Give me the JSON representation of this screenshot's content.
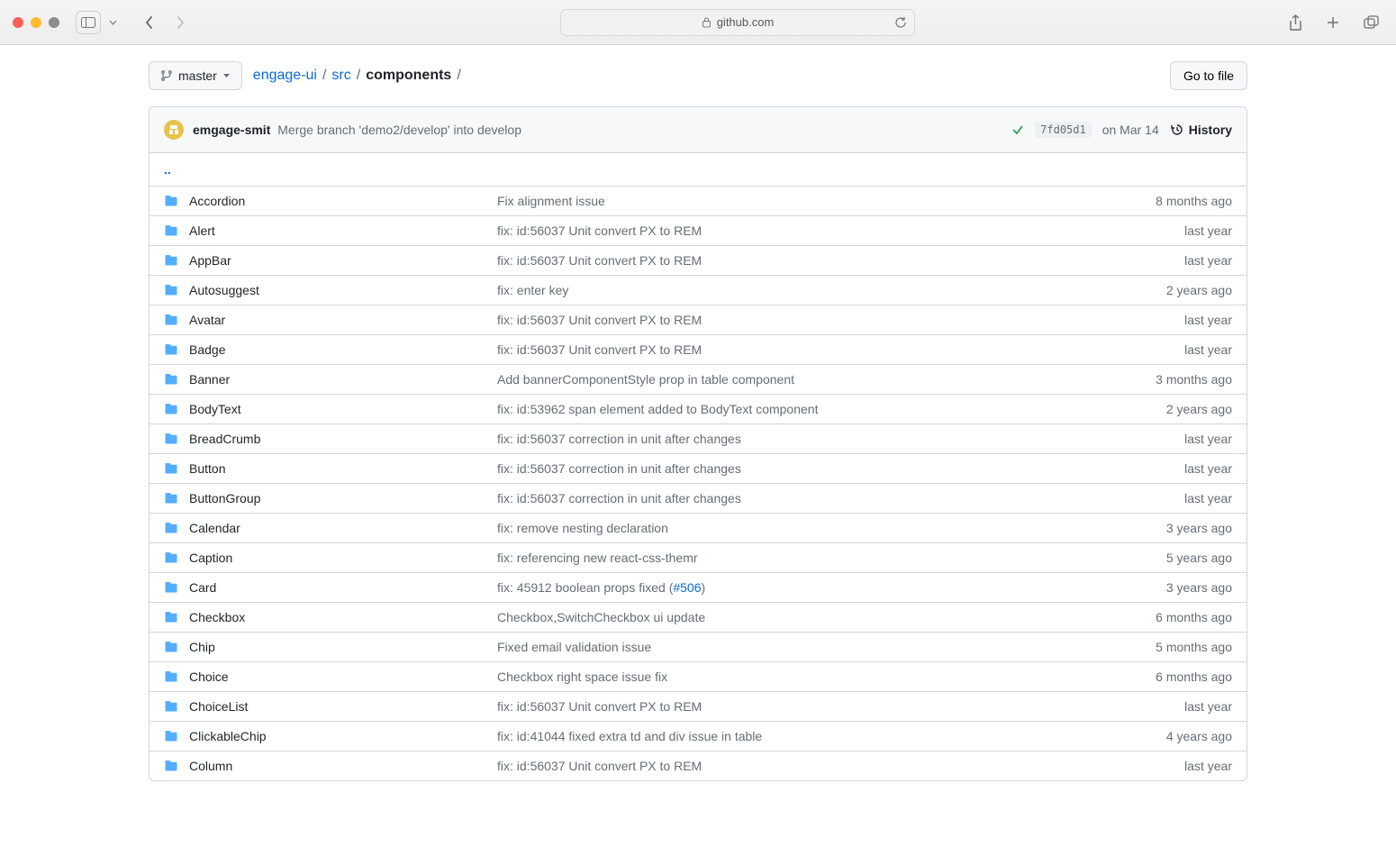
{
  "browser": {
    "domain": "github.com"
  },
  "branch": {
    "label": "master"
  },
  "breadcrumbs": {
    "repo": "engage-ui",
    "path1": "src",
    "current": "components"
  },
  "go_to_file": "Go to file",
  "commit": {
    "author": "emgage-smit",
    "message": "Merge branch 'demo2/develop' into develop",
    "sha": "7fd05d1",
    "date": "on Mar 14",
    "history": "History"
  },
  "parent_link": "..",
  "files": [
    {
      "name": "Accordion",
      "msg": "Fix alignment issue",
      "time": "8 months ago"
    },
    {
      "name": "Alert",
      "msg": "fix: id:56037 Unit convert PX to REM",
      "time": "last year"
    },
    {
      "name": "AppBar",
      "msg": "fix: id:56037 Unit convert PX to REM",
      "time": "last year"
    },
    {
      "name": "Autosuggest",
      "msg": "fix: enter key",
      "time": "2 years ago"
    },
    {
      "name": "Avatar",
      "msg": "fix: id:56037 Unit convert PX to REM",
      "time": "last year"
    },
    {
      "name": "Badge",
      "msg": "fix: id:56037 Unit convert PX to REM",
      "time": "last year"
    },
    {
      "name": "Banner",
      "msg": "Add bannerComponentStyle prop in table component",
      "time": "3 months ago"
    },
    {
      "name": "BodyText",
      "msg": "fix: id:53962 span element added to BodyText component",
      "time": "2 years ago"
    },
    {
      "name": "BreadCrumb",
      "msg": "fix: id:56037 correction in unit after changes",
      "time": "last year"
    },
    {
      "name": "Button",
      "msg": "fix: id:56037 correction in unit after changes",
      "time": "last year"
    },
    {
      "name": "ButtonGroup",
      "msg": "fix: id:56037 correction in unit after changes",
      "time": "last year"
    },
    {
      "name": "Calendar",
      "msg": "fix: remove nesting declaration",
      "time": "3 years ago"
    },
    {
      "name": "Caption",
      "msg": "fix: referencing new react-css-themr",
      "time": "5 years ago"
    },
    {
      "name": "Card",
      "msg": "fix: 45912 boolean props fixed (",
      "msg_link": "#506",
      "msg_after": ")",
      "time": "3 years ago"
    },
    {
      "name": "Checkbox",
      "msg": "Checkbox,SwitchCheckbox ui update",
      "time": "6 months ago"
    },
    {
      "name": "Chip",
      "msg": "Fixed email validation issue",
      "time": "5 months ago"
    },
    {
      "name": "Choice",
      "msg": "Checkbox right space issue fix",
      "time": "6 months ago"
    },
    {
      "name": "ChoiceList",
      "msg": "fix: id:56037 Unit convert PX to REM",
      "time": "last year"
    },
    {
      "name": "ClickableChip",
      "msg": "fix: id:41044 fixed extra td and div issue in table",
      "time": "4 years ago"
    },
    {
      "name": "Column",
      "msg": "fix: id:56037 Unit convert PX to REM",
      "time": "last year"
    }
  ]
}
